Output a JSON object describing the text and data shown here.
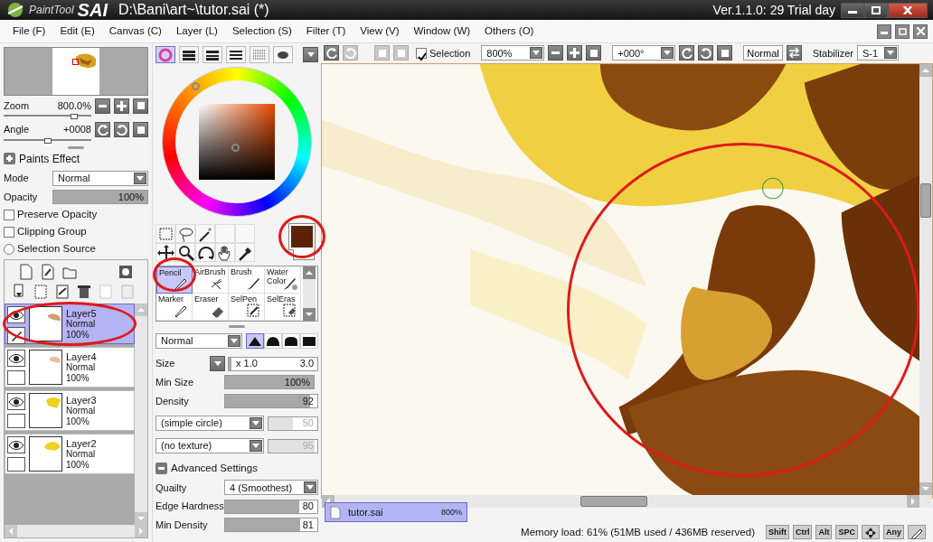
{
  "window": {
    "logo_main": "PaintTool",
    "logo_brand": "SAI",
    "title": "D:\\Bani\\art~\\tutor.sai (*)",
    "version": "Ver.1.1.0: 29 Trial day"
  },
  "menu": [
    "File (F)",
    "Edit (E)",
    "Canvas (C)",
    "Layer (L)",
    "Selection (S)",
    "Filter (T)",
    "View (V)",
    "Window (W)",
    "Others (O)"
  ],
  "navigator": {
    "zoom": {
      "label": "Zoom",
      "value": "800.0%",
      "level": 0.8
    },
    "angle": {
      "label": "Angle",
      "value": "+0008",
      "level": 0.5
    }
  },
  "paints_effect": {
    "label": "Paints Effect",
    "expanded": false
  },
  "mode": {
    "label": "Mode",
    "value": "Normal"
  },
  "opacity": {
    "label": "Opacity",
    "value": "100%",
    "level": 1
  },
  "options": [
    {
      "kind": "checkbox",
      "label": "Preserve Opacity",
      "checked": false
    },
    {
      "kind": "checkbox",
      "label": "Clipping Group",
      "checked": false
    },
    {
      "kind": "radio",
      "label": "Selection Source",
      "checked": false
    }
  ],
  "layers": [
    {
      "name": "Layer5",
      "mode": "Normal",
      "opacity": "100%",
      "visible": true,
      "editing": true,
      "selected": true
    },
    {
      "name": "Layer4",
      "mode": "Normal",
      "opacity": "100%",
      "visible": true,
      "editing": false,
      "selected": false
    },
    {
      "name": "Layer3",
      "mode": "Normal",
      "opacity": "100%",
      "visible": true,
      "editing": false,
      "selected": false
    },
    {
      "name": "Layer2",
      "mode": "Normal",
      "opacity": "100%",
      "visible": true,
      "editing": false,
      "selected": false
    }
  ],
  "color_tabs": [
    {
      "selected": true
    },
    {
      "selected": false
    },
    {
      "selected": false
    },
    {
      "selected": false
    },
    {
      "selected": false
    },
    {
      "selected": false
    }
  ],
  "brushes": [
    {
      "label": "Pencil",
      "selected": true
    },
    {
      "label": "AirBrush",
      "selected": false
    },
    {
      "label": "Brush",
      "selected": false
    },
    {
      "label": "Water Color",
      "selected": false
    },
    {
      "label": "Marker",
      "selected": false
    },
    {
      "label": "Eraser",
      "selected": false
    },
    {
      "label": "SelPen",
      "selected": false
    },
    {
      "label": "SelEras",
      "selected": false
    }
  ],
  "brush_settings": {
    "blend": "Normal",
    "shapes": [
      {
        "selected": true
      },
      {
        "selected": false
      },
      {
        "selected": false
      },
      {
        "selected": false
      }
    ],
    "size": {
      "label": "Size",
      "multiplier": "x 1.0",
      "value": "3.0",
      "level": 0.03
    },
    "min_size": {
      "label": "Min Size",
      "value": "100%",
      "level": 1
    },
    "density": {
      "label": "Density",
      "value": "92",
      "level": 0.92
    },
    "shape": {
      "value": "(simple circle)",
      "amount": "50",
      "level": 0.5,
      "disabled": true
    },
    "texture": {
      "value": "(no texture)",
      "amount": "95",
      "level": 0.95,
      "disabled": true
    },
    "advanced": {
      "label": "Advanced Settings",
      "expanded": true
    },
    "quality": {
      "label": "Quailty",
      "value": "4 (Smoothest)"
    },
    "edge_hardness": {
      "label": "Edge Hardness",
      "value": "80",
      "level": 0.8
    },
    "min_density": {
      "label": "Min Density",
      "value": "81",
      "level": 0.81
    }
  },
  "canvas_toolbar": {
    "selection": {
      "label": "Selection",
      "checked": true
    },
    "zoom": "800%",
    "angle": "+000°",
    "blend": "Normal",
    "stabilizer_label": "Stabilizer",
    "stabilizer": "S-1"
  },
  "document_tabs": [
    {
      "name": "tutor.sai",
      "zoom": "800%",
      "selected": true
    }
  ],
  "status": {
    "memory": "Memory load: 61% (51MB used / 436MB reserved)",
    "keys": [
      {
        "kind": "text",
        "label": "Shift"
      },
      {
        "kind": "text",
        "label": "Ctrl"
      },
      {
        "kind": "text",
        "label": "Alt"
      },
      {
        "kind": "text",
        "label": "SPC"
      },
      {
        "kind": "move"
      },
      {
        "kind": "text",
        "label": "Any"
      },
      {
        "kind": "pen"
      }
    ]
  }
}
